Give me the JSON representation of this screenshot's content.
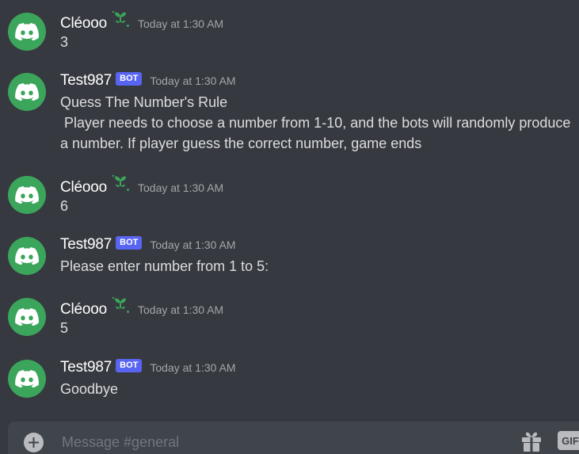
{
  "colors": {
    "background": "#36393f",
    "avatar": "#3ba55c",
    "bot_tag": "#5865f2",
    "username": "#ffffff",
    "message_text": "#dcddde",
    "timestamp": "#a3a6aa",
    "input_bg": "#40444b"
  },
  "messages": [
    {
      "username": "Cléooo",
      "is_bot": false,
      "timestamp": "Today at 1:30 AM",
      "lines": [
        "3"
      ]
    },
    {
      "username": "Test987",
      "is_bot": true,
      "bot_tag": "BOT",
      "timestamp": "Today at 1:30 AM",
      "lines": [
        "Quess The Number's Rule",
        " Player needs to choose a number from 1-10, and the bots will randomly produce a number. If player guess the correct number, game ends"
      ]
    },
    {
      "username": "Cléooo",
      "is_bot": false,
      "timestamp": "Today at 1:30 AM",
      "lines": [
        "6"
      ]
    },
    {
      "username": "Test987",
      "is_bot": true,
      "bot_tag": "BOT",
      "timestamp": "Today at 1:30 AM",
      "lines": [
        "Please enter number from 1 to 5:"
      ]
    },
    {
      "username": "Cléooo",
      "is_bot": false,
      "timestamp": "Today at 1:30 AM",
      "lines": [
        "5"
      ]
    },
    {
      "username": "Test987",
      "is_bot": true,
      "bot_tag": "BOT",
      "timestamp": "Today at 1:30 AM",
      "lines": [
        "Goodbye"
      ]
    }
  ],
  "composer": {
    "placeholder": "Message #general",
    "gif_label": "GIF",
    "icons": [
      "plus-icon",
      "gift-icon"
    ]
  }
}
